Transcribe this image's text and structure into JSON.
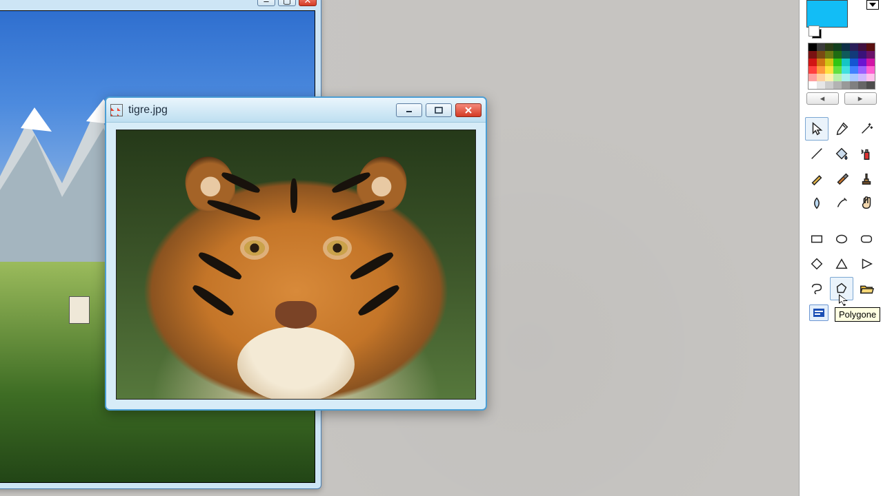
{
  "bg_window": {
    "controls": {
      "min": "–",
      "max": "▢",
      "close": "✕"
    }
  },
  "front_window": {
    "title": "tigre.jpg",
    "controls": {
      "min": "—",
      "max": "❐",
      "close": "✕"
    }
  },
  "side_panel": {
    "current_color": "#12bdf6",
    "palette": [
      "#000000",
      "#3b3b3b",
      "#2b3d17",
      "#123f1e",
      "#0e2f46",
      "#2a1f5a",
      "#401040",
      "#5a0f0f",
      "#7a1212",
      "#7a4a12",
      "#6c7a12",
      "#1f6c12",
      "#0f5a5a",
      "#123a7a",
      "#3a127a",
      "#6a126a",
      "#d11515",
      "#d17515",
      "#d1c515",
      "#30c515",
      "#15c5c5",
      "#1555d1",
      "#6a15d1",
      "#d115a5",
      "#ff4040",
      "#ff9a40",
      "#ffe040",
      "#62e040",
      "#40e0e0",
      "#4080ff",
      "#9a60ff",
      "#ff60d0",
      "#ffa0a0",
      "#ffd0a0",
      "#fff0b0",
      "#b8f0a8",
      "#a8f0f0",
      "#a8c8ff",
      "#d0b8ff",
      "#ffc0ec",
      "#ffffff",
      "#e6e6e6",
      "#cccccc",
      "#b3b3b3",
      "#999999",
      "#808080",
      "#666666",
      "#4d4d4d"
    ],
    "tools": [
      "pointer",
      "eyedropper",
      "magic-wand",
      "line",
      "fill",
      "spray",
      "pencil",
      "brush",
      "stamp",
      "blur",
      "smudge",
      "hand"
    ],
    "shapes": [
      "rectangle",
      "ellipse",
      "rounded-rect",
      "diamond",
      "triangle",
      "play-triangle",
      "lasso",
      "polygon",
      "open-folder"
    ],
    "text_tool": "text"
  },
  "tooltip": {
    "label": "Polygone"
  }
}
